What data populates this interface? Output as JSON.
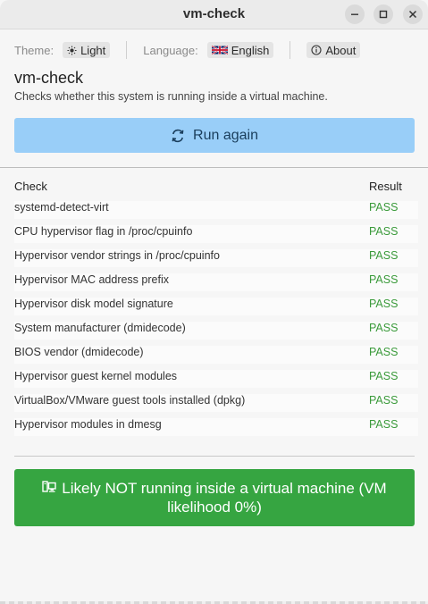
{
  "window": {
    "title": "vm-check"
  },
  "settings": {
    "theme_label": "Theme:",
    "theme_value": "Light",
    "language_label": "Language:",
    "language_value": "English",
    "about_label": "About"
  },
  "header": {
    "title": "vm-check",
    "subtitle": "Checks whether this system is running inside a virtual machine."
  },
  "run_button": {
    "label": "Run again"
  },
  "table": {
    "columns": [
      "Check",
      "Result"
    ],
    "rows": [
      {
        "check": "systemd-detect-virt",
        "result": "PASS"
      },
      {
        "check": "CPU hypervisor flag in /proc/cpuinfo",
        "result": "PASS"
      },
      {
        "check": "Hypervisor vendor strings in /proc/cpuinfo",
        "result": "PASS"
      },
      {
        "check": "Hypervisor MAC address prefix",
        "result": "PASS"
      },
      {
        "check": "Hypervisor disk model signature",
        "result": "PASS"
      },
      {
        "check": "System manufacturer (dmidecode)",
        "result": "PASS"
      },
      {
        "check": "BIOS vendor (dmidecode)",
        "result": "PASS"
      },
      {
        "check": "Hypervisor guest kernel modules",
        "result": "PASS"
      },
      {
        "check": "VirtualBox/VMware guest tools installed (dpkg)",
        "result": "PASS"
      },
      {
        "check": "Hypervisor modules in dmesg",
        "result": "PASS"
      }
    ]
  },
  "verdict": {
    "text": "Likely NOT running inside a virtual machine (VM likelihood 0%)"
  },
  "colors": {
    "run_button_bg": "#99cef8",
    "verdict_bg": "#36a541",
    "pass": "#3a9a3a"
  },
  "icons": {
    "theme": "sun-icon",
    "language": "uk-flag-icon",
    "about": "info-icon",
    "run": "refresh-icon",
    "verdict": "computer-icon"
  }
}
